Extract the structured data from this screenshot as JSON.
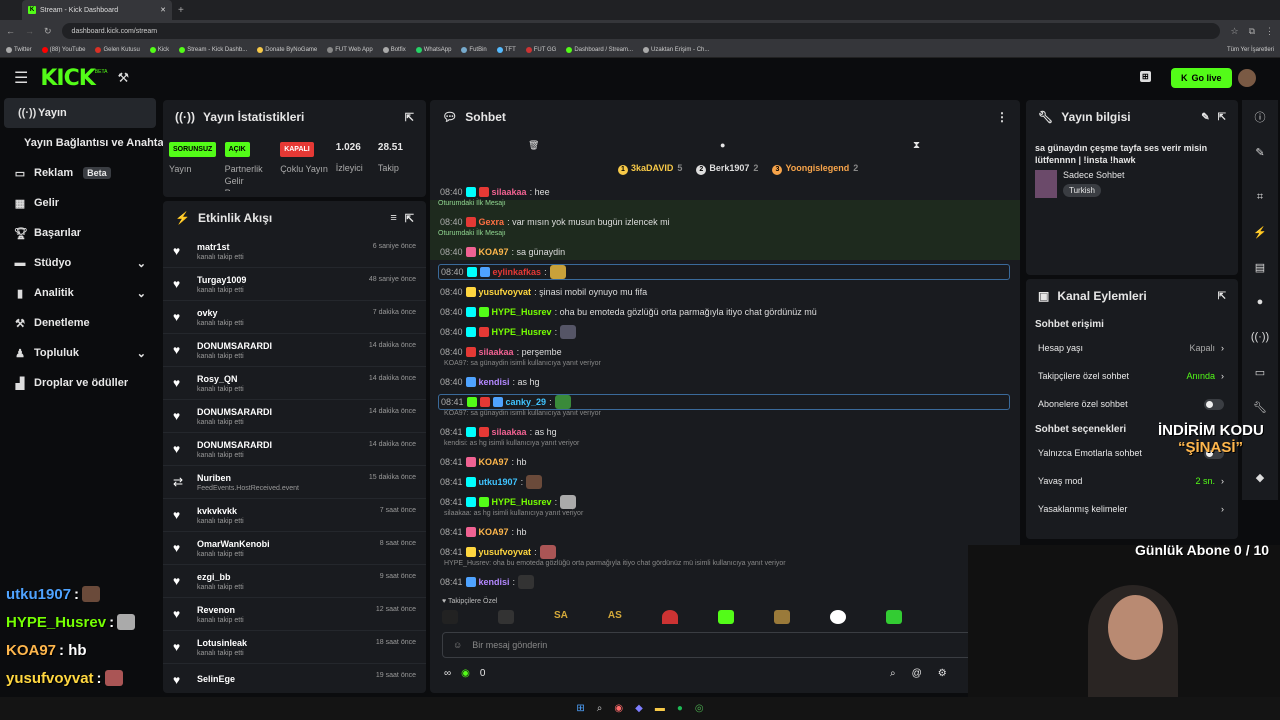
{
  "browser": {
    "tab_title": "Stream - Kick Dashboard",
    "url": "dashboard.kick.com/stream",
    "bookmarks": [
      "Twitter",
      "(88) YouTube",
      "Gelen Kutusu",
      "Kick",
      "Stream - Kick Dashb...",
      "Donate ByNoGame",
      "FUT Web App",
      "Botfix",
      "WhatsApp",
      "FutBin",
      "TFT",
      "FUT GG",
      "Dashboard / Stream...",
      "Uzaktan Erişim - Ch..."
    ],
    "all_bookmarks": "Tüm Yer İşaretleri"
  },
  "topbar": {
    "logo": "KICK",
    "logo_sup": "BETA",
    "go_live": "Go live"
  },
  "sidebar": {
    "items": [
      {
        "label": "Yayın",
        "icon": "broadcast-icon"
      },
      {
        "label": "Yayın Bağlantısı ve Anahtarı",
        "icon": ""
      },
      {
        "label": "Reklam",
        "icon": "ad-icon",
        "badge": "Beta"
      },
      {
        "label": "Gelir",
        "icon": "revenue-icon"
      },
      {
        "label": "Başarılar",
        "icon": "trophy-icon"
      },
      {
        "label": "Stüdyo",
        "icon": "studio-icon",
        "chevron": true
      },
      {
        "label": "Analitik",
        "icon": "chart-icon",
        "chevron": true
      },
      {
        "label": "Denetleme",
        "icon": "moderation-icon"
      },
      {
        "label": "Topluluk",
        "icon": "community-icon",
        "chevron": true
      },
      {
        "label": "Droplar ve ödüller",
        "icon": "drops-icon"
      }
    ]
  },
  "stats": {
    "title": "Yayın İstatistikleri",
    "items": [
      {
        "badge": "SORUNSUZ",
        "label": "Yayın"
      },
      {
        "badge": "AÇIK",
        "label": "Partnerlik Gelir Programı"
      },
      {
        "badge": "KAPALI",
        "label": "Çoklu Yayın"
      },
      {
        "value": "1.026",
        "label": "İzleyici"
      },
      {
        "value": "28.51",
        "label": "Takip"
      }
    ]
  },
  "activity": {
    "title": "Etkinlik Akışı",
    "items": [
      {
        "name": "matr1st",
        "sub": "kanalı takip etti",
        "time": "6 saniye önce"
      },
      {
        "name": "Turgay1009",
        "sub": "kanalı takip etti",
        "time": "48 saniye önce"
      },
      {
        "name": "ovky",
        "sub": "kanalı takip etti",
        "time": "7 dakika önce"
      },
      {
        "name": "DONUMSARARDI",
        "sub": "kanalı takip etti",
        "time": "14 dakika önce"
      },
      {
        "name": "Rosy_QN",
        "sub": "kanalı takip etti",
        "time": "14 dakika önce"
      },
      {
        "name": "DONUMSARARDI",
        "sub": "kanalı takip etti",
        "time": "14 dakika önce"
      },
      {
        "name": "DONUMSARARDI",
        "sub": "kanalı takip etti",
        "time": "14 dakika önce"
      },
      {
        "name": "Nuriben",
        "sub": "FeedEvents.HostReceived.event",
        "time": "15 dakika önce"
      },
      {
        "name": "kvkvkvkk",
        "sub": "kanalı takip etti",
        "time": "7 saat önce"
      },
      {
        "name": "OmarWanKenobi",
        "sub": "kanalı takip etti",
        "time": "8 saat önce"
      },
      {
        "name": "ezgi_bb",
        "sub": "kanalı takip etti",
        "time": "9 saat önce"
      },
      {
        "name": "Revenon",
        "sub": "kanalı takip etti",
        "time": "12 saat önce"
      },
      {
        "name": "Lotusinleak",
        "sub": "kanalı takip etti",
        "time": "18 saat önce"
      },
      {
        "name": "SelinEge",
        "sub": "",
        "time": "19 saat önce"
      }
    ]
  },
  "chat": {
    "title": "Sohbet",
    "leaders": [
      {
        "rank": "1",
        "name": "3kaDAVID",
        "count": "5"
      },
      {
        "rank": "2",
        "name": "Berk1907",
        "count": "2"
      },
      {
        "rank": "3",
        "name": "Yoongislegend",
        "count": "2"
      }
    ],
    "first_msg_label": "Oturumdaki İlk Mesajı",
    "messages": [
      {
        "time": "08:40",
        "user": "silaakaa",
        "color": "#f06292",
        "text": ": hee"
      },
      {
        "time": "08:40",
        "user": "Gexra",
        "color": "#ff7043",
        "text": ": var mısın yok musun bugün izlencek mi",
        "first": true
      },
      {
        "time": "08:40",
        "user": "KOA97",
        "color": "#ffb74d",
        "text": ": sa günaydin",
        "first": true
      },
      {
        "time": "08:40",
        "user": "eylinkafkas",
        "color": "#e53935",
        "text": ":"
      },
      {
        "time": "08:40",
        "user": "yusufvoyvat",
        "color": "#ffd740",
        "text": ": şinasi mobil oynuyo mu fifa"
      },
      {
        "time": "08:40",
        "user": "HYPE_Husrev",
        "color": "#76ff03",
        "text": ": oha bu emoteda gözlüğü orta parmağıyla itiyo chat gördünüz mü"
      },
      {
        "time": "08:40",
        "user": "HYPE_Husrev",
        "color": "#76ff03",
        "text": ":"
      },
      {
        "time": "08:40",
        "user": "silaakaa",
        "color": "#f06292",
        "text": ": perşembe"
      },
      {
        "time": "08:40",
        "user": "kendisi",
        "color": "#b388ff",
        "text": ": as hg",
        "reply": "KOA97: sa günaydin isimli kullanıcıya yanıt veriyor"
      },
      {
        "time": "08:41",
        "user": "canky_29",
        "color": "#40c4ff",
        "text": ":"
      },
      {
        "time": "08:41",
        "user": "silaakaa",
        "color": "#f06292",
        "text": ": as hg",
        "reply": "KOA97: sa günaydin isimli kullanıcıya yanıt veriyor"
      },
      {
        "time": "08:41",
        "user": "KOA97",
        "color": "#ffb74d",
        "text": ": hb",
        "reply": "kendisi: as hg isimli kullanıcıya yanıt veriyor"
      },
      {
        "time": "08:41",
        "user": "utku1907",
        "color": "#40c4ff",
        "text": ":"
      },
      {
        "time": "08:41",
        "user": "HYPE_Husrev",
        "color": "#76ff03",
        "text": ":"
      },
      {
        "time": "08:41",
        "user": "KOA97",
        "color": "#ffb74d",
        "text": ": hb",
        "reply": "silaakaa: as hg isimli kullanıcıya yanıt veriyor"
      },
      {
        "time": "08:41",
        "user": "yusufvoyvat",
        "color": "#ffd740",
        "text": ":"
      },
      {
        "time": "08:41",
        "user": "kendisi",
        "color": "#b388ff",
        "text": ":",
        "reply": "HYPE_Husrev: oha bu emoteda gözlüğü orta parmağıyla itiyo chat gördünüz mü isimli kullanıcıya yanıt veriyor"
      }
    ],
    "followers_only": "Takipçilere Özel",
    "input_placeholder": "Bir mesaj gönderin",
    "points": "0"
  },
  "stream_info": {
    "title": "Yayın bilgisi",
    "stream_title": "sa günaydın çeşme tayfa ses verir misin lütfennnn | !insta !hawk",
    "category": "Sadece Sohbet",
    "language": "Turkish"
  },
  "channel_actions": {
    "title": "Kanal Eylemleri",
    "section1": "Sohbet erişimi",
    "rows1": [
      {
        "label": "Hesap yaşı",
        "value": "Kapalı",
        "value_color": "#aaaaaa"
      },
      {
        "label": "Takipçilere özel sohbet",
        "value": "Anında",
        "value_color": "#53fc18"
      },
      {
        "label": "Abonelere özel sohbet",
        "toggle": true
      }
    ],
    "section2": "Sohbet seçenekleri",
    "rows2": [
      {
        "label": "Yalnızca Emotlarla sohbet",
        "toggle": true
      },
      {
        "label": "Yavaş mod",
        "value": "2 sn.",
        "value_color": "#53fc18"
      },
      {
        "label": "Yasaklanmış kelimeler",
        "value": ""
      }
    ]
  },
  "overlay": {
    "promo_line1": "İNDİRİM KODU",
    "promo_line2": "“ŞİNASİ”",
    "sub_goal": "Günlük Abone 0 / 10",
    "chat": [
      {
        "user": "utku1907",
        "color": "#4fa3ff",
        "text": ":"
      },
      {
        "user": "HYPE_Husrev",
        "color": "#76ff03",
        "text": ":"
      },
      {
        "user": "KOA97",
        "color": "#ffb74d",
        "text": ": hb"
      },
      {
        "user": "yusufvoyvat",
        "color": "#ffd740",
        "text": ":"
      },
      {
        "user": "kendisi",
        "color": "#b388ff",
        "text": ":"
      }
    ]
  }
}
